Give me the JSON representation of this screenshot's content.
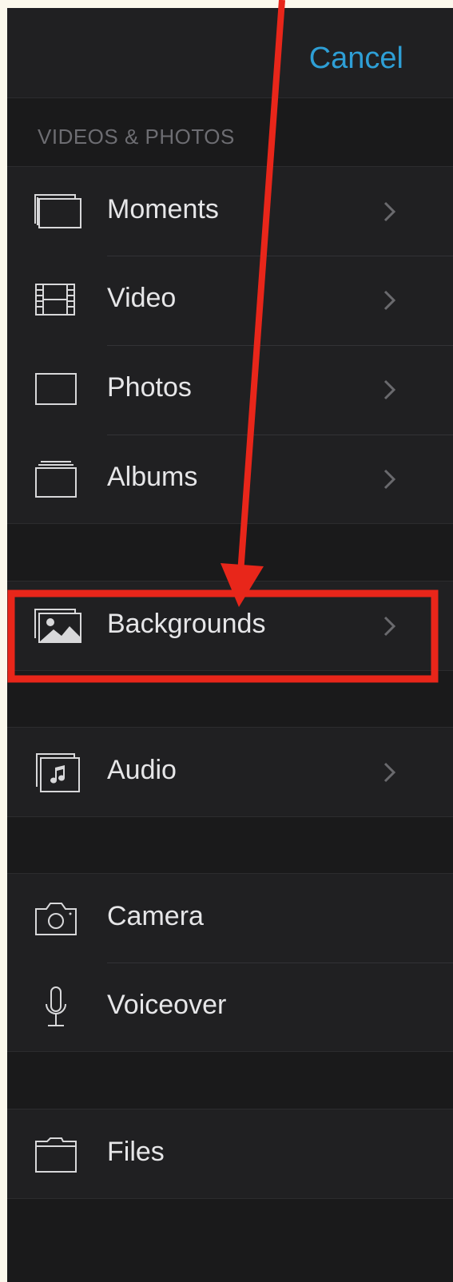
{
  "header": {
    "cancel_label": "Cancel"
  },
  "section": {
    "title": "VIDEOS & PHOTOS"
  },
  "items": [
    {
      "id": "moments",
      "label": "Moments",
      "icon": "moments-icon",
      "chevron": true
    },
    {
      "id": "video",
      "label": "Video",
      "icon": "film-icon",
      "chevron": true
    },
    {
      "id": "photos",
      "label": "Photos",
      "icon": "photo-frame-icon",
      "chevron": true
    },
    {
      "id": "albums",
      "label": "Albums",
      "icon": "albums-icon",
      "chevron": true
    },
    {
      "id": "backgrounds",
      "label": "Backgrounds",
      "icon": "landscape-image-icon",
      "chevron": true
    },
    {
      "id": "audio",
      "label": "Audio",
      "icon": "music-note-icon",
      "chevron": true
    },
    {
      "id": "camera",
      "label": "Camera",
      "icon": "camera-icon",
      "chevron": false
    },
    {
      "id": "voiceover",
      "label": "Voiceover",
      "icon": "microphone-icon",
      "chevron": false
    },
    {
      "id": "files",
      "label": "Files",
      "icon": "folder-icon",
      "chevron": false
    }
  ],
  "colors": {
    "accent": "#2e9fd6",
    "annotation": "#e8261a",
    "background": "#1a1a1b",
    "row": "#202022",
    "text": "#e6e6e8"
  }
}
